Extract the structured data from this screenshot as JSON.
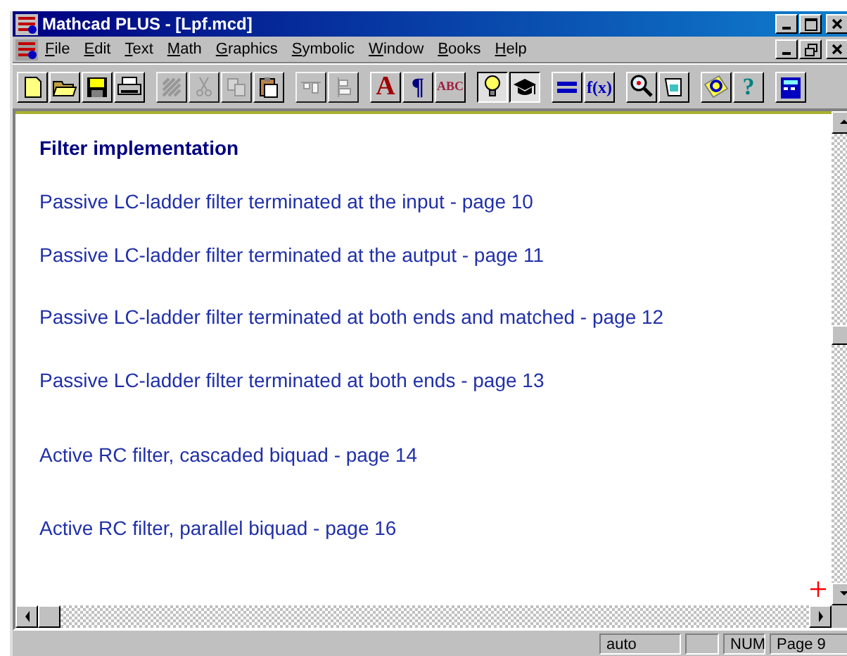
{
  "window": {
    "title": "Mathcad PLUS - [Lpf.mcd]"
  },
  "menu": [
    "File",
    "Edit",
    "Text",
    "Math",
    "Graphics",
    "Symbolic",
    "Window",
    "Books",
    "Help"
  ],
  "toolbar": [
    {
      "kind": "icon",
      "disabled": false,
      "pressed": false
    },
    {
      "kind": "icon",
      "disabled": false,
      "pressed": false
    },
    {
      "kind": "icon",
      "disabled": false,
      "pressed": false
    },
    {
      "kind": "icon",
      "disabled": false,
      "pressed": false
    },
    {
      "kind": "sep"
    },
    {
      "kind": "icon",
      "disabled": true,
      "pressed": false
    },
    {
      "kind": "icon",
      "disabled": true,
      "pressed": false
    },
    {
      "kind": "icon",
      "disabled": true,
      "pressed": false
    },
    {
      "kind": "icon",
      "disabled": false,
      "pressed": false
    },
    {
      "kind": "sep"
    },
    {
      "kind": "icon",
      "disabled": true,
      "pressed": false
    },
    {
      "kind": "icon",
      "disabled": true,
      "pressed": false
    },
    {
      "kind": "sep"
    },
    {
      "kind": "text",
      "label": "A",
      "disabled": false,
      "pressed": false
    },
    {
      "kind": "text",
      "label": "¶",
      "disabled": false,
      "pressed": false
    },
    {
      "kind": "text",
      "label": "ABC",
      "disabled": false,
      "pressed": false
    },
    {
      "kind": "sep"
    },
    {
      "kind": "icon",
      "disabled": false,
      "pressed": true
    },
    {
      "kind": "icon",
      "disabled": false,
      "pressed": true
    },
    {
      "kind": "sep"
    },
    {
      "kind": "icon",
      "disabled": false,
      "pressed": false
    },
    {
      "kind": "text",
      "label": "f(x)",
      "disabled": false,
      "pressed": false
    },
    {
      "kind": "sep"
    },
    {
      "kind": "icon",
      "disabled": false,
      "pressed": false
    },
    {
      "kind": "icon",
      "disabled": false,
      "pressed": false
    },
    {
      "kind": "sep"
    },
    {
      "kind": "icon",
      "disabled": false,
      "pressed": false
    },
    {
      "kind": "text",
      "label": "?",
      "disabled": false,
      "pressed": false
    },
    {
      "kind": "sep"
    },
    {
      "kind": "icon",
      "disabled": false,
      "pressed": false
    }
  ],
  "document": {
    "heading": "Filter implementation",
    "links": [
      "Passive LC-ladder filter terminated at the input  - page 10",
      "Passive LC-ladder filter terminated at the autput - page 11",
      "Passive LC-ladder filter terminated at both ends and matched - page 12",
      "Passive LC-ladder filter terminated at both ends - page 13",
      "Active RC filter, cascaded biquad - page 14",
      "Active RC filter, parallel biquad - page 16"
    ]
  },
  "status_bar": [
    "auto",
    "NUM",
    "Page 9"
  ]
}
